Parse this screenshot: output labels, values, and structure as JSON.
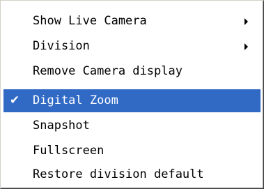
{
  "menu": {
    "items": [
      {
        "label": "Show Live Camera",
        "has_submenu": true,
        "checked": false,
        "selected": false
      },
      {
        "label": "Division",
        "has_submenu": true,
        "checked": false,
        "selected": false
      },
      {
        "label": "Remove Camera display",
        "has_submenu": false,
        "checked": false,
        "selected": false
      },
      {
        "label": "Digital Zoom",
        "has_submenu": false,
        "checked": true,
        "selected": true,
        "check_glyph": "✔"
      },
      {
        "label": "Snapshot",
        "has_submenu": false,
        "checked": false,
        "selected": false
      },
      {
        "label": "Fullscreen",
        "has_submenu": false,
        "checked": false,
        "selected": false
      },
      {
        "label": "Restore division default",
        "has_submenu": false,
        "checked": false,
        "selected": false
      }
    ],
    "colors": {
      "highlight_bg": "#316ac5",
      "highlight_text": "#ffffff",
      "text": "#000000",
      "background": "#ffffff"
    },
    "icons": {
      "submenu": "submenu-arrow-icon",
      "check": "checkmark-icon"
    }
  }
}
